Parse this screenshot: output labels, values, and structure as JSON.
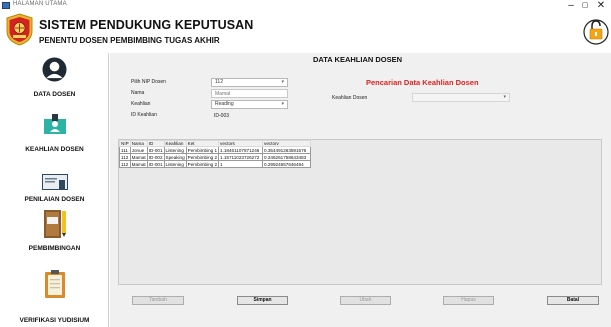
{
  "window": {
    "title": "HALAMAN UTAMA",
    "minimize": "–",
    "maximize": "▢",
    "close": "✕"
  },
  "header": {
    "title": "SISTEM PENDUKUNG KEPUTUSAN",
    "subtitle": "PENENTU DOSEN PEMBIMBING TUGAS AKHIR"
  },
  "sidebar": {
    "items": [
      {
        "label": "DATA DOSEN",
        "icon": "user-avatar-icon"
      },
      {
        "label": "KEAHLIAN DOSEN",
        "icon": "id-card-icon"
      },
      {
        "label": "PENILAIAN DOSEN",
        "icon": "certificate-icon"
      },
      {
        "label": "PEMBIMBINGAN",
        "icon": "notebook-pencil-icon"
      },
      {
        "label": "VERIFIKASI YUDISIUM",
        "icon": "clipboard-icon"
      }
    ]
  },
  "form": {
    "title": "DATA KEAHLIAN DOSEN",
    "nip_label": "Pilih NIP Dosen",
    "nip_value": "112",
    "nama_label": "Nama",
    "nama_placeholder": "Mamat",
    "keahlian_label": "Keahlian",
    "keahlian_value": "Reading",
    "id_keahlian_label": "ID Keahlian",
    "id_keahlian_value": "ID-003"
  },
  "search": {
    "title": "Pencarian Data Keahlian Dosen",
    "keahlian_label": "Keahlian Dosen",
    "keahlian_value": ""
  },
  "table": {
    "columns": [
      "NIP",
      "Nama",
      "ID",
      "Keahlian",
      "Ket",
      "vectors",
      "vectorv"
    ],
    "rows": [
      [
        "111",
        "Jonue",
        "ID-001",
        "Listening",
        "Pembimbing 1",
        "1.18461107871246",
        "0.354491263591576"
      ],
      [
        "112",
        "Mamat",
        "ID-002",
        "Speaking",
        "Pembimbing 2",
        "1.15711023726272",
        "0.346261758643483"
      ],
      [
        "112",
        "Mamat",
        "ID-001",
        "Listening",
        "Pembimbing 2",
        "1",
        "0.29924657646494"
      ]
    ]
  },
  "buttons": {
    "tambah": "Tambah",
    "simpan": "Simpan",
    "ubah": "Ubah",
    "hapus": "Hapus",
    "batal": "Batal"
  },
  "colors": {
    "accent_red": "#e1211f",
    "sidebar_bg": "#ffffff",
    "main_bg": "#f0f0f0"
  }
}
